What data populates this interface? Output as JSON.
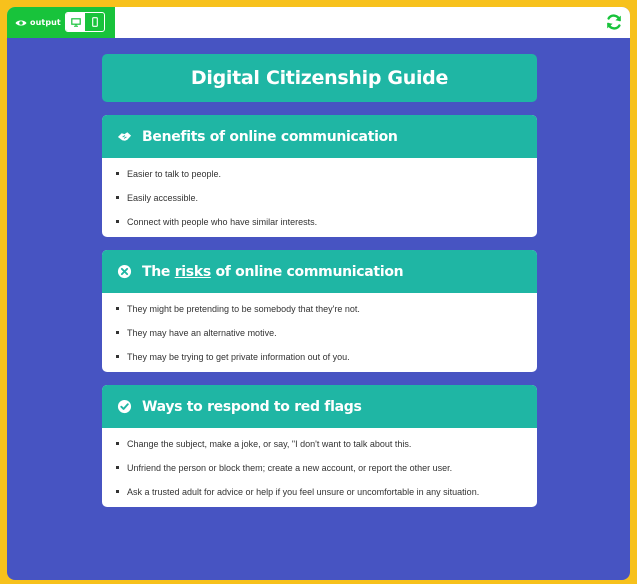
{
  "topbar": {
    "output_label": "output",
    "icons": [
      "eye-icon",
      "desktop-icon",
      "mobile-icon",
      "refresh-icon"
    ],
    "colors": {
      "output_green": "#18c33b",
      "refresh_green": "#18c33b"
    }
  },
  "page": {
    "title": "Digital Citizenship Guide",
    "colors": {
      "background": "#4754c2",
      "card_header": "#1fb6a4",
      "frame": "#f7c11c"
    }
  },
  "sections": [
    {
      "icon": "handshake-icon",
      "title": "Benefits of online communication",
      "items": [
        "Easier to talk to people.",
        "Easily accessible.",
        "Connect with people who have similar interests."
      ]
    },
    {
      "icon": "x-circle-icon",
      "title_pre": "The ",
      "title_emph": "risks",
      "title_post": " of online communication",
      "items": [
        "They might be pretending to be somebody that they're not.",
        "They may have an alternative motive.",
        "They may be trying to get private information out of you."
      ]
    },
    {
      "icon": "check-circle-icon",
      "title": "Ways to respond to red flags",
      "items": [
        "Change the subject, make a joke, or say, \"I don't want to talk about this.",
        "Unfriend the person or block them; create a new account, or report the other user.",
        "Ask a trusted adult for advice or help if you feel unsure or uncomfortable in any situation."
      ]
    }
  ]
}
